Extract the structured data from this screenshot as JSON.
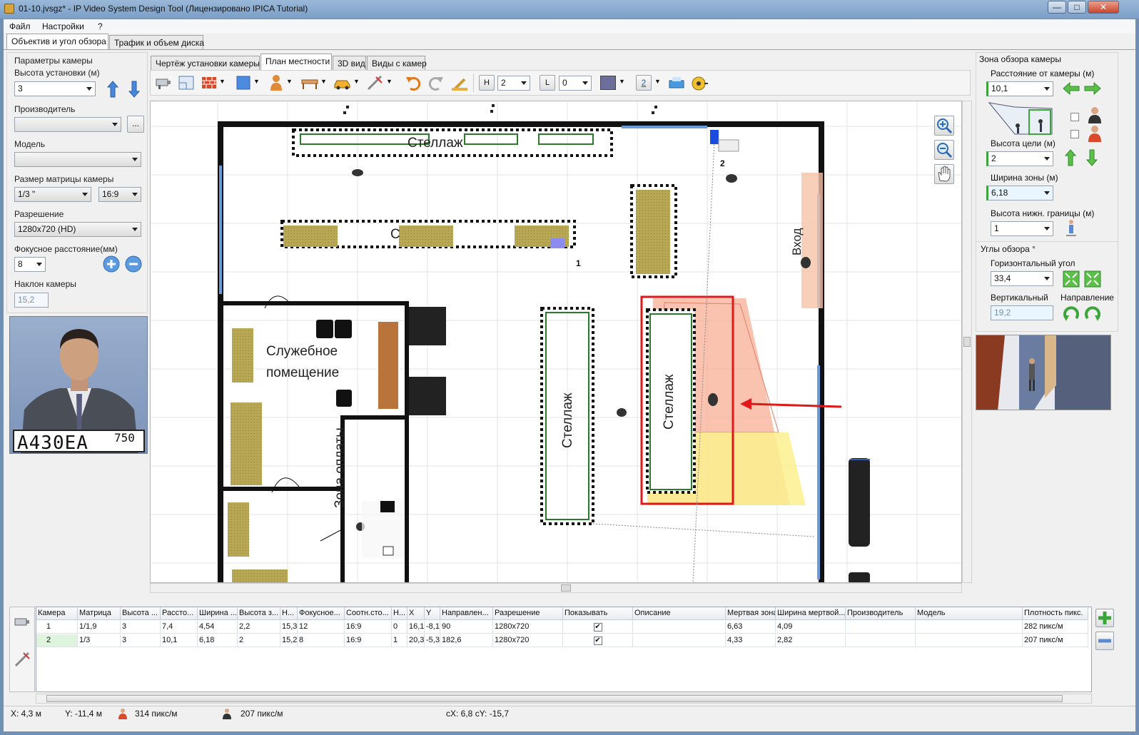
{
  "window": {
    "title": "01-10.jvsgz* - IP Video System Design Tool (Лицензировано  IPICA Tutorial)",
    "min": "—",
    "max": "□",
    "close": "✕"
  },
  "menu": [
    "Файл",
    "Настройки",
    "?"
  ],
  "main_tabs": [
    "Объектив и угол обзора",
    "Трафик и объем диска"
  ],
  "left": {
    "section": "Параметры камеры",
    "height_label": "Высота установки (м)",
    "height_value": "3",
    "manufacturer_label": "Производитель",
    "manufacturer_value": "",
    "browse": "...",
    "model_label": "Модель",
    "model_value": "",
    "sensor_label": "Размер матрицы камеры",
    "sensor_value": "1/3 \"",
    "aspect_value": "16:9",
    "resolution_label": "Разрешение",
    "resolution_value": "1280x720 (HD)",
    "focal_label": "Фокусное расстояние(мм)",
    "focal_value": "8",
    "tilt_label": "Наклон камеры",
    "tilt_value": "15,2",
    "plate_text": "A430EA",
    "plate_region": "750"
  },
  "view_tabs": [
    "Чертёж установки камеры",
    "План местности",
    "3D вид",
    "Виды с камер"
  ],
  "toolbar": {
    "h_value": "2",
    "l_value": "0",
    "zoom_value": "2",
    "h_label": "H",
    "l_label": "L"
  },
  "plan": {
    "shelf_top": "Стеллаж",
    "shelf_mid": "С",
    "service_room": "Служебное\nпомещение",
    "pay_zone": "Зона оплаты",
    "shelf_v1": "Стеллаж",
    "shelf_v2": "Стеллаж",
    "entrance": "Вход",
    "cam1": "1",
    "cam2": "2"
  },
  "right": {
    "section": "Зона обзора камеры",
    "distance_label": "Расстояние от камеры (м)",
    "distance_value": "10,1",
    "target_height_label": "Высота цели (м)",
    "target_height_value": "2",
    "zone_width_label": "Ширина зоны (м)",
    "zone_width_value": "6,18",
    "lower_bound_label": "Высота нижн. границы (м)",
    "lower_bound_value": "1",
    "angles_section": "Углы обзора °",
    "h_angle_label": "Горизонтальный угол",
    "h_angle_value": "33,4",
    "v_angle_label": "Вертикальный",
    "v_angle_value": "19,2",
    "direction_label": "Направление"
  },
  "table": {
    "columns": [
      "Камера",
      "Матрица",
      "Высота ...",
      "Рассто...",
      "Ширина ...",
      "Высота з...",
      "Н...",
      "Фокусное...",
      "Соотн.сто...",
      "Н...",
      "X",
      "Y",
      "Направлен...",
      "Разрешение",
      "Показывать",
      "Описание",
      "Мертвая зона",
      "Ширина мертвой...",
      "Производитель",
      "Модель",
      "Плотность пикс."
    ],
    "rows": [
      [
        "1",
        "1/1,9",
        "3",
        "7,4",
        "4,54",
        "2,2",
        "15,3",
        "12",
        "16:9",
        "0",
        "16,1",
        "-8,1",
        "90",
        "1280x720",
        "✔",
        "",
        "6,63",
        "4,09",
        "",
        "",
        "282 пикс/м"
      ],
      [
        "2",
        "1/3",
        "3",
        "10,1",
        "6,18",
        "2",
        "15,2",
        "8",
        "16:9",
        "1",
        "20,3",
        "-5,3",
        "182,6",
        "1280x720",
        "✔",
        "",
        "4,33",
        "2,82",
        "",
        "",
        "207 пикс/м"
      ]
    ]
  },
  "status": {
    "x": "X: 4,3 м",
    "y": "Y: -11,4 м",
    "density1": "314 пикс/м",
    "density2": "207 пикс/м",
    "cxy": "cX: 6,8 cY: -15,7"
  }
}
